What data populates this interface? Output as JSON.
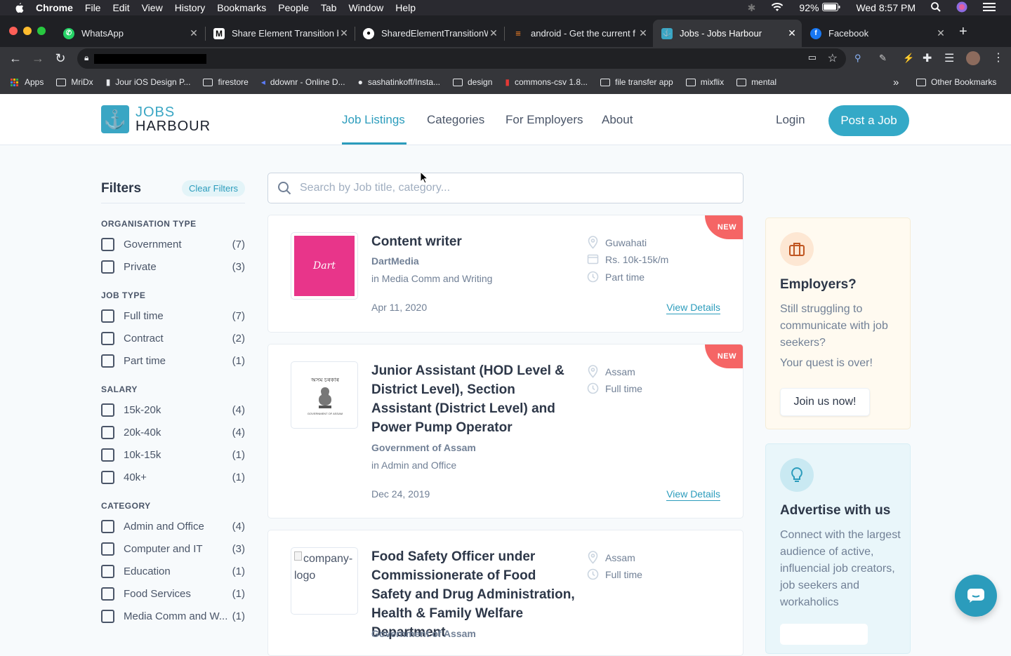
{
  "menubar": {
    "app": "Chrome",
    "items": [
      "File",
      "Edit",
      "View",
      "History",
      "Bookmarks",
      "People",
      "Tab",
      "Window",
      "Help"
    ],
    "battery": "92%",
    "clock": "Wed 8:57 PM"
  },
  "tabs": [
    {
      "title": "WhatsApp",
      "favicon": "whatsapp-icon"
    },
    {
      "title": "Share Element Transition b",
      "favicon": "medium-icon"
    },
    {
      "title": "SharedElementTransitionW",
      "favicon": "github-icon"
    },
    {
      "title": "android - Get the current f",
      "favicon": "stackoverflow-icon"
    },
    {
      "title": "Jobs - Jobs Harbour",
      "favicon": "jobs-harbour-icon",
      "active": true
    },
    {
      "title": "Facebook",
      "favicon": "facebook-icon"
    }
  ],
  "bookmarks": {
    "apps": "Apps",
    "items": [
      "MriDx",
      "Jour iOS Design P...",
      "firestore",
      "ddownr - Online D...",
      "sashatinkoff/Insta...",
      "design",
      "commons-csv 1.8...",
      "file transfer app",
      "mixflix",
      "mental"
    ],
    "overflow": "»",
    "other": "Other Bookmarks"
  },
  "site": {
    "brand": {
      "line1": "JOBS",
      "line2": "HARBOUR",
      "color": "#3aa6c4"
    },
    "nav": [
      "Job Listings",
      "Categories",
      "For Employers",
      "About"
    ],
    "login": "Login",
    "post_job": "Post a Job",
    "accent": "#2b9cbc"
  },
  "filters": {
    "title": "Filters",
    "clear": "Clear Filters",
    "groups": [
      {
        "title": "ORGANISATION TYPE",
        "options": [
          {
            "label": "Government",
            "count": "(7)"
          },
          {
            "label": "Private",
            "count": "(3)"
          }
        ]
      },
      {
        "title": "JOB TYPE",
        "options": [
          {
            "label": "Full time",
            "count": "(7)"
          },
          {
            "label": "Contract",
            "count": "(2)"
          },
          {
            "label": "Part time",
            "count": "(1)"
          }
        ]
      },
      {
        "title": "SALARY",
        "options": [
          {
            "label": "15k-20k",
            "count": "(4)"
          },
          {
            "label": "20k-40k",
            "count": "(4)"
          },
          {
            "label": "10k-15k",
            "count": "(1)"
          },
          {
            "label": "40k+",
            "count": "(1)"
          }
        ]
      },
      {
        "title": "CATEGORY",
        "options": [
          {
            "label": "Admin and Office",
            "count": "(4)"
          },
          {
            "label": "Computer and IT",
            "count": "(3)"
          },
          {
            "label": "Education",
            "count": "(1)"
          },
          {
            "label": "Food Services",
            "count": "(1)"
          },
          {
            "label": "Media Comm and W...",
            "count": "(1)"
          }
        ]
      }
    ]
  },
  "search": {
    "placeholder": "Search by Job title, category..."
  },
  "jobs": [
    {
      "title": "Content writer",
      "company": "DartMedia",
      "category": "in Media Comm and Writing",
      "date": "Apr 11, 2020",
      "location": "Guwahati",
      "salary": "Rs. 10k-15k/m",
      "type": "Part time",
      "badge": "NEW",
      "details": "View Details",
      "logo_text": "Dart"
    },
    {
      "title": "Junior Assistant (HOD Level & District Level), Section Assistant (District Level) and Power Pump Operator",
      "company": "Government of Assam",
      "category": "in Admin and Office",
      "date": "Dec 24, 2019",
      "location": "Assam",
      "type": "Full time",
      "badge": "NEW",
      "details": "View Details",
      "logo_text": "অসম চৰকাৰ",
      "logo_caption": "GOVERNMENT OF ASSAM"
    },
    {
      "title": "Food Safety Officer under Commissionerate of Food Safety and Drug Administration, Health & Family Welfare Department",
      "company": "Government of Assam",
      "location": "Assam",
      "type": "Full time",
      "logo_alt": "company-logo"
    }
  ],
  "employers_box": {
    "title": "Employers?",
    "text1": "Still struggling to communicate with job seekers?",
    "text2": "Your quest is over!",
    "button": "Join us now!"
  },
  "advertise_box": {
    "title": "Advertise with us",
    "text": "Connect with the largest audience of active, influencial job creators, job seekers and workaholics"
  }
}
